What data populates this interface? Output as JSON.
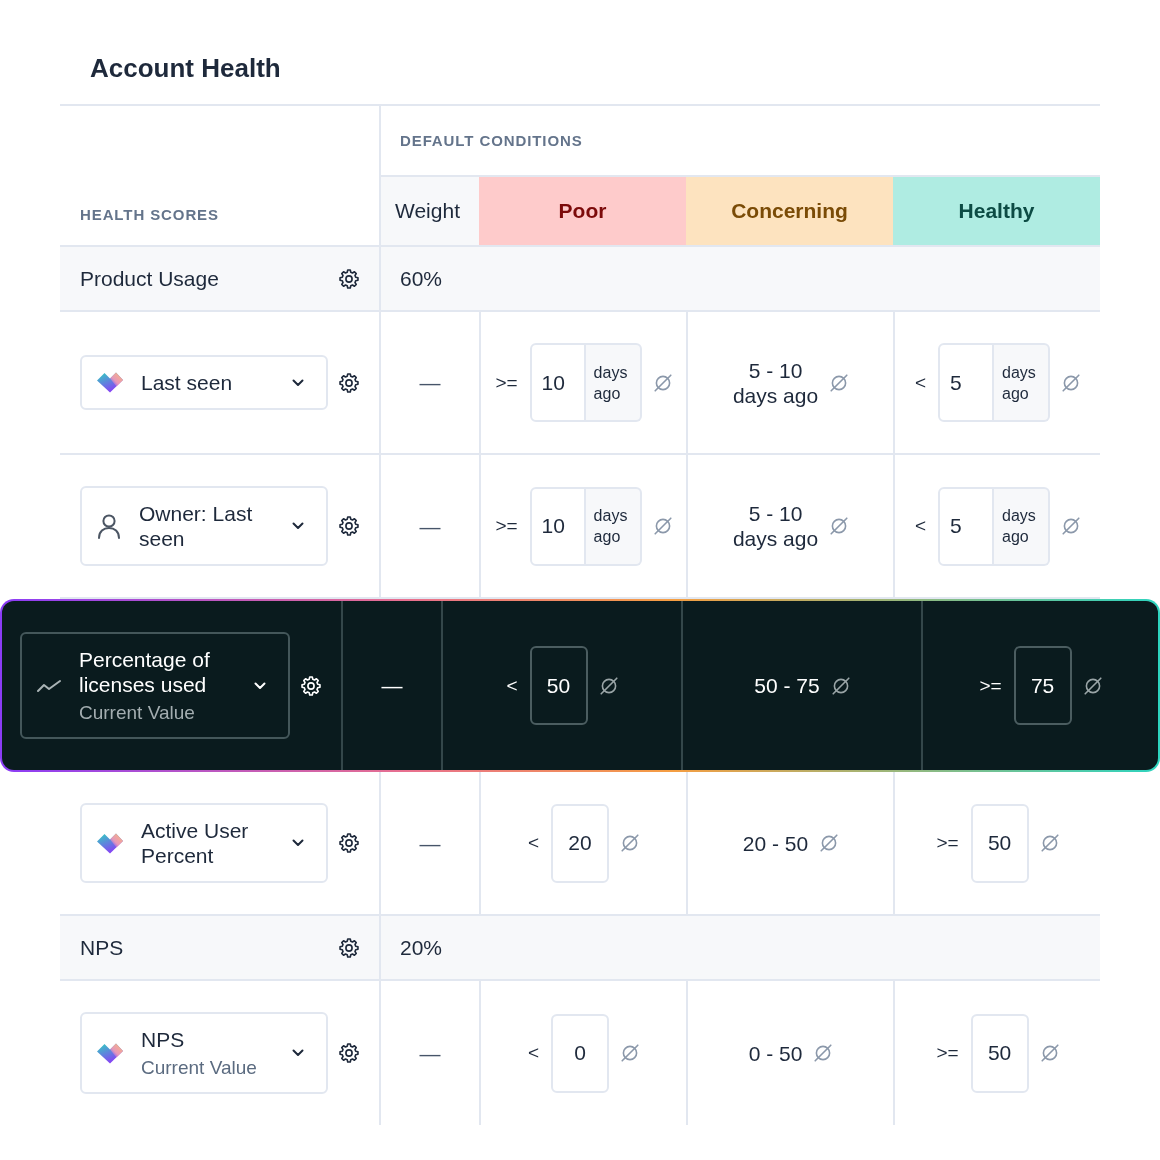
{
  "title": "Account Health",
  "table": {
    "row_header": "HEALTH SCORES",
    "conditions_header": "DEFAULT CONDITIONS",
    "columns": [
      {
        "label": "Weight",
        "kind": "weight"
      },
      {
        "label": "Poor",
        "kind": "poor"
      },
      {
        "label": "Concerning",
        "kind": "concerning"
      },
      {
        "label": "Healthy",
        "kind": "healthy"
      }
    ],
    "groups": [
      {
        "name": "Product Usage",
        "weight": "60%",
        "metrics": [
          {
            "kind": "integration",
            "name": "Last seen",
            "highlighted": false,
            "weight": "—",
            "conditions": [
              {
                "kind": "input",
                "operator": ">=",
                "value": "10",
                "unit": "days ago"
              },
              {
                "kind": "range",
                "range": "5 - 10",
                "unit": "days ago"
              },
              {
                "kind": "input",
                "operator": "<",
                "value": "5",
                "unit": "days ago"
              }
            ]
          },
          {
            "kind": "user",
            "name": "Owner: Last seen",
            "highlighted": false,
            "weight": "—",
            "conditions": [
              {
                "kind": "input",
                "operator": ">=",
                "value": "10",
                "unit": "days ago"
              },
              {
                "kind": "range",
                "range": "5 - 10",
                "unit": "days ago"
              },
              {
                "kind": "input",
                "operator": "<",
                "value": "5",
                "unit": "days ago"
              }
            ]
          },
          {
            "kind": "calculated",
            "name": "Percentage of licenses used",
            "subtitle": "Current Value",
            "highlighted": true,
            "weight": "—",
            "conditions": [
              {
                "kind": "input",
                "operator": "<",
                "value": "50"
              },
              {
                "kind": "range",
                "range": "50 - 75"
              },
              {
                "kind": "input",
                "operator": ">=",
                "value": "75"
              }
            ]
          },
          {
            "kind": "integration",
            "name": "Active User Percent",
            "highlighted": false,
            "weight": "—",
            "conditions": [
              {
                "kind": "input",
                "operator": "<",
                "value": "20"
              },
              {
                "kind": "range",
                "range": "20 - 50"
              },
              {
                "kind": "input",
                "operator": ">=",
                "value": "50"
              }
            ]
          }
        ]
      },
      {
        "name": "NPS",
        "weight": "20%",
        "metrics": [
          {
            "kind": "integration",
            "name": "NPS",
            "subtitle": "Current Value",
            "highlighted": false,
            "weight": "—",
            "conditions": [
              {
                "kind": "input",
                "operator": "<",
                "value": "0"
              },
              {
                "kind": "range",
                "range": "0 - 50"
              },
              {
                "kind": "input",
                "operator": ">=",
                "value": "50"
              }
            ]
          }
        ]
      }
    ]
  }
}
